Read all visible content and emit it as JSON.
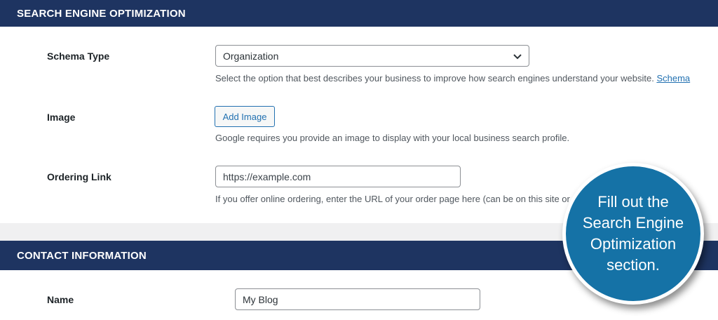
{
  "seo": {
    "header": "SEARCH ENGINE OPTIMIZATION",
    "schema_type": {
      "label": "Schema Type",
      "selected": "Organization",
      "description": "Select the option that best describes your business to improve how search engines understand your website.",
      "link_text": "Schema"
    },
    "image": {
      "label": "Image",
      "button_label": "Add Image",
      "description": "Google requires you provide an image to display with your local business search profile."
    },
    "ordering_link": {
      "label": "Ordering Link",
      "placeholder": "https://example.com",
      "description": "If you offer online ordering, enter the URL of your order page here (can be on this site or a third party). It will"
    }
  },
  "contact": {
    "header": "CONTACT INFORMATION",
    "name": {
      "label": "Name",
      "value": "My Blog"
    }
  },
  "callout": {
    "text": "Fill out the Search Engine Optimization section."
  },
  "colors": {
    "header_bg": "#1e3461",
    "callout_bg": "#1572a6",
    "link": "#2271b1"
  }
}
